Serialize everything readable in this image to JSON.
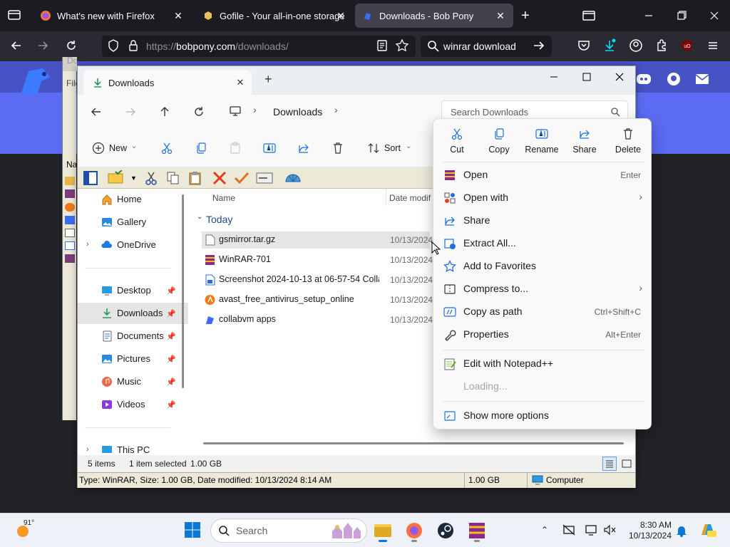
{
  "firefox": {
    "tabs": [
      {
        "title": "What's new with Firefox"
      },
      {
        "title": "Gofile - Your all-in-one storage"
      },
      {
        "title": "Downloads - Bob Pony"
      }
    ],
    "url_prefix": "https://",
    "url_domain": "bobpony.com",
    "url_path": "/downloads/",
    "search_text": "winrar download"
  },
  "old_window": {
    "title": "Downloads (collabvm.com)",
    "menu_label": "File",
    "col_label": "Na"
  },
  "explorer": {
    "tab_title": "Downloads",
    "breadcrumb": "Downloads",
    "search_placeholder": "Search Downloads",
    "commands": {
      "new": "New",
      "sort": "Sort"
    },
    "nav": [
      {
        "label": "Home",
        "icon": "home-icon"
      },
      {
        "label": "Gallery",
        "icon": "gallery-icon"
      },
      {
        "label": "OneDrive",
        "icon": "onedrive-icon"
      },
      {
        "label": "Desktop",
        "icon": "desktop-icon"
      },
      {
        "label": "Downloads",
        "icon": "downloads-icon"
      },
      {
        "label": "Documents",
        "icon": "documents-icon"
      },
      {
        "label": "Pictures",
        "icon": "pictures-icon"
      },
      {
        "label": "Music",
        "icon": "music-icon"
      },
      {
        "label": "Videos",
        "icon": "videos-icon"
      },
      {
        "label": "This PC",
        "icon": "this-pc-icon"
      }
    ],
    "columns": {
      "name": "Name",
      "date": "Date modif"
    },
    "group": "Today",
    "files": [
      {
        "name": "gsmirror.tar.gz",
        "date": "10/13/2024"
      },
      {
        "name": "WinRAR-701",
        "date": "10/13/2024"
      },
      {
        "name": "Screenshot 2024-10-13 at 06-57-54 Colla...",
        "date": "10/13/2024"
      },
      {
        "name": "avast_free_antivirus_setup_online",
        "date": "10/13/2024"
      },
      {
        "name": "collabvm apps",
        "date": "10/13/2024"
      }
    ],
    "status": {
      "items": "5 items",
      "selected": "1 item selected",
      "size": "1.00 GB"
    },
    "status2": {
      "info": "Type: WinRAR, Size: 1.00 GB, Date modified: 10/13/2024 8:14 AM",
      "size": "1.00 GB",
      "location": "Computer"
    }
  },
  "context_menu": {
    "top_actions": [
      "Cut",
      "Copy",
      "Rename",
      "Share",
      "Delete"
    ],
    "items": [
      {
        "label": "Open",
        "shortcut": "Enter"
      },
      {
        "label": "Open with",
        "shortcut": ""
      },
      {
        "label": "Share",
        "shortcut": ""
      },
      {
        "label": "Extract All...",
        "shortcut": ""
      },
      {
        "label": "Add to Favorites",
        "shortcut": ""
      },
      {
        "label": "Compress to...",
        "shortcut": ""
      },
      {
        "label": "Copy as path",
        "shortcut": "Ctrl+Shift+C"
      },
      {
        "label": "Properties",
        "shortcut": "Alt+Enter"
      },
      {
        "label": "Edit with Notepad++",
        "shortcut": ""
      },
      {
        "label": "Loading...",
        "shortcut": ""
      },
      {
        "label": "Show more options",
        "shortcut": ""
      }
    ]
  },
  "taskbar": {
    "weather_temp": "91°",
    "search_placeholder": "Search",
    "time": "8:30 AM",
    "date": "10/13/2024"
  }
}
